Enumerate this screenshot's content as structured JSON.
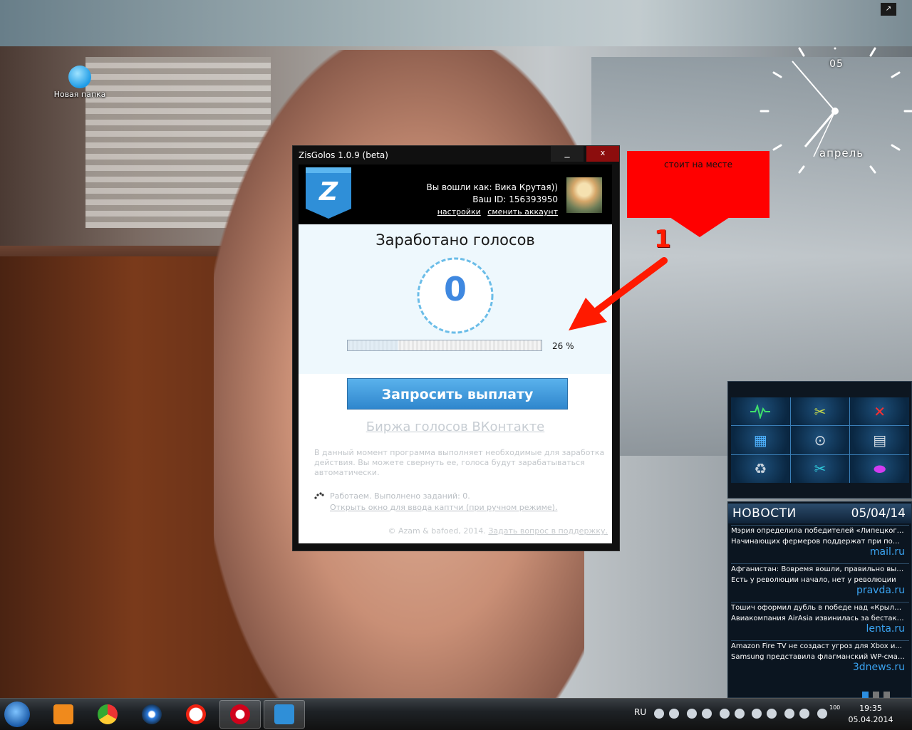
{
  "desktop": {
    "icons": [
      {
        "label": "Новая папка",
        "icon": "folder-icon"
      }
    ]
  },
  "clock_gadget": {
    "day": "05",
    "month": "апрель"
  },
  "dialog": {
    "title": "ZisGolos 1.0.9 (beta)",
    "minimize_label": "_",
    "close_label": "x",
    "account": {
      "logged_in_as": "Вы вошли как: Вика Крутая))",
      "user_id": "Ваш ID: 156393950",
      "settings_link": "настройки",
      "switch_account_link": "сменить аккаунт"
    },
    "earned_title": "Заработано голосов",
    "earned_count": "0",
    "progress": {
      "fraction": 0.26,
      "label": "26 %"
    },
    "payout_button": "Запросить выплату",
    "exchange_link": "Биржа голосов ВКонтакте",
    "info_text": "В данный момент программа выполняет необходимые для заработка действия. Вы можете свернуть ее, голоса будут зарабатываться автоматически.",
    "status_text": "Работаем. Выполнено заданий: 0.",
    "captcha_link": "Открыть окно для ввода каптчи (при ручном режиме).",
    "footer_copyright": "© Azam & bafoed, 2014.",
    "footer_link": "Задать вопрос в поддержку."
  },
  "annotation": {
    "callout_text": "стоит на месте",
    "marker": "1"
  },
  "tools_gadget": {
    "icons": [
      "pulse-icon",
      "tools-icon",
      "cross-icon",
      "calculator-icon",
      "mouse-icon",
      "document-icon",
      "recycle-icon",
      "scissors-icon",
      "palette-icon"
    ]
  },
  "news_gadget": {
    "title": "НОВОСТИ",
    "date": "05/04/14",
    "items": [
      {
        "line1": "Мэрия определила победителей «Липецкого...",
        "line2": "Начинающих фермеров поддержат при помо...",
        "source": "mail.ru"
      },
      {
        "line1": "Афганистан: Вовремя вошли, правильно выш...",
        "line2": "Есть у революции начало, нет у революции",
        "source": "pravda.ru"
      },
      {
        "line1": "Тошич оформил дубль в победе над «Крылья...",
        "line2": "Авиакомпания AirAsia извинилась за бестакт...",
        "source": "lenta.ru"
      },
      {
        "line1": "Amazon Fire TV не создаст угроз для Xbox и...",
        "line2": "Samsung представила флагманский WP-смар...",
        "source": "3dnews.ru"
      }
    ]
  },
  "taskbar": {
    "apps": [
      "start-icon",
      "media-player-icon",
      "chrome-icon",
      "browser-icon",
      "yandex-icon",
      "opera-icon",
      "zisgolos-icon"
    ],
    "language": "RU",
    "volume": "100",
    "time": "19:35",
    "date": "05.04.2014"
  },
  "colors": {
    "accent": "#3f88e0",
    "callout": "#ff0000",
    "button": "#2f86cd"
  }
}
